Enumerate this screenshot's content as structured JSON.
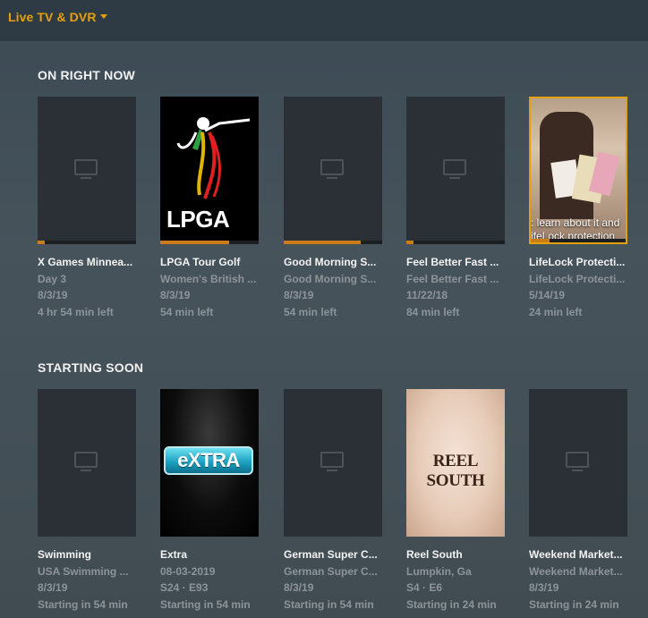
{
  "header": {
    "title": "Live TV & DVR"
  },
  "sections": {
    "on_now": {
      "title": "ON RIGHT NOW",
      "items": [
        {
          "title": "X Games Minnea...",
          "subtitle": "Day 3",
          "date": "8/3/19",
          "status": "4 hr 54 min left",
          "progress": 0.07
        },
        {
          "title": "LPGA Tour Golf",
          "subtitle": "Women's British ...",
          "date": "8/3/19",
          "status": "54 min left",
          "progress": 0.7,
          "poster_text": "LPGA"
        },
        {
          "title": "Good Morning S...",
          "subtitle": "Good Morning S...",
          "date": "8/3/19",
          "status": "54 min left",
          "progress": 0.78
        },
        {
          "title": "Feel Better Fast ...",
          "subtitle": "Feel Better Fast ...",
          "date": "11/22/18",
          "status": "84 min left",
          "progress": 0.07
        },
        {
          "title": "LifeLock Protecti...",
          "subtitle": "LifeLock Protecti...",
          "date": "5/14/19",
          "status": "24 min left",
          "progress": 0.2,
          "caption_1": ": learn about it and",
          "caption_2": "ifeLock protection"
        }
      ]
    },
    "starting_soon": {
      "title": "STARTING SOON",
      "items": [
        {
          "title": "Swimming",
          "subtitle": "USA Swimming ...",
          "date": "8/3/19",
          "status": "Starting in 54 min"
        },
        {
          "title": "Extra",
          "subtitle": "08-03-2019",
          "date": "S24 · E93",
          "status": "Starting in 54 min",
          "poster_text": "eXTRA"
        },
        {
          "title": "German Super C...",
          "subtitle": "German Super C...",
          "date": "8/3/19",
          "status": "Starting in 54 min"
        },
        {
          "title": "Reel South",
          "subtitle": "Lumpkin, Ga",
          "date": "S4 · E6",
          "status": "Starting in 24 min",
          "poster_text": "REEL SOUTH"
        },
        {
          "title": "Weekend Market...",
          "subtitle": "Weekend Market...",
          "date": "8/3/19",
          "status": "Starting in 24 min"
        }
      ]
    }
  },
  "colors": {
    "accent": "#e5a00d",
    "progress": "#cc7b19",
    "card_bg": "#2b3036"
  }
}
